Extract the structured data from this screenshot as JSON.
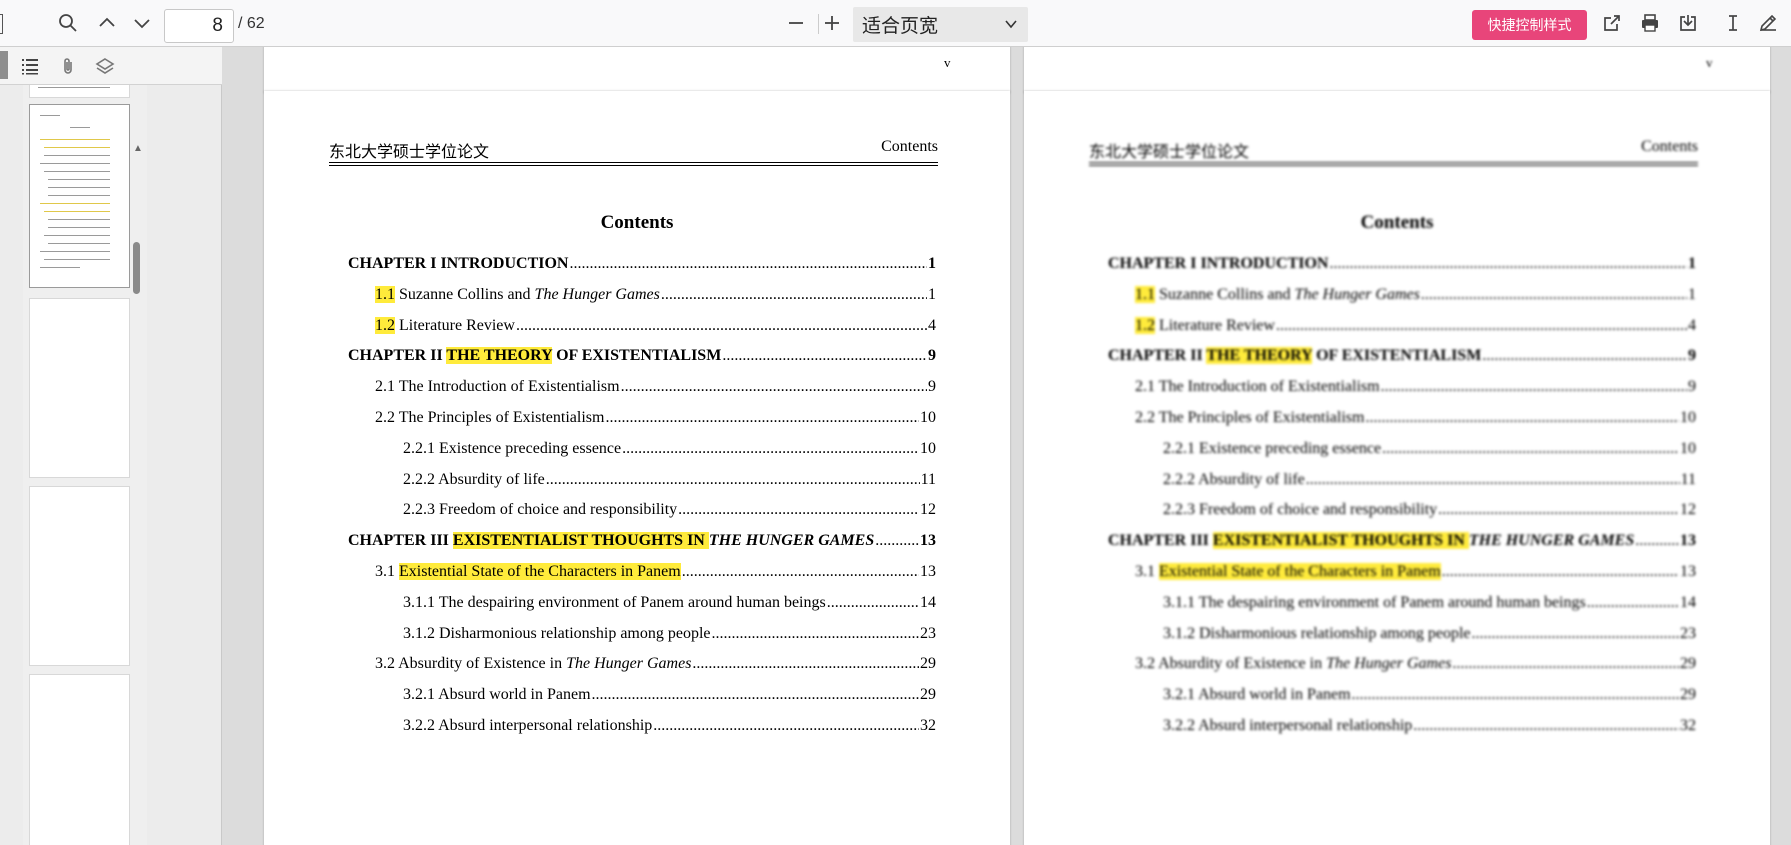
{
  "toolbar": {
    "page_current": "8",
    "page_total": "/ 62",
    "zoom_label": "适合页宽",
    "quick_style_label": "快捷控制样式",
    "icons": [
      "search-icon",
      "chevron-up-icon",
      "chevron-down-icon",
      "zoom-out-icon",
      "zoom-in-icon",
      "open-external-icon",
      "print-icon",
      "download-icon",
      "text-cursor-icon",
      "pen-icon"
    ]
  },
  "sidebar": {
    "tabs": [
      "outline-list-icon",
      "attachment-icon",
      "layers-icon"
    ]
  },
  "prev_page": {
    "left_mark": "v",
    "right_mark": "v"
  },
  "page": {
    "header_left": "东北大学硕士学位论文",
    "header_right": "Contents",
    "title": "Contents"
  },
  "toc": [
    {
      "parts": [
        {
          "t": "CHAPTER I INTRODUCTION"
        }
      ],
      "page": "1",
      "level": 0
    },
    {
      "parts": [
        {
          "t": "1.1",
          "hl": true
        },
        {
          "t": " Suzanne Collins and "
        },
        {
          "t": "The Hunger Games",
          "it": true
        }
      ],
      "page": "1",
      "level": 1
    },
    {
      "parts": [
        {
          "t": "1.2",
          "hl": true
        },
        {
          "t": " Literature Review"
        }
      ],
      "page": "4",
      "level": 1
    },
    {
      "parts": [
        {
          "t": "CHAPTER II "
        },
        {
          "t": "THE THEORY",
          "hl": true
        },
        {
          "t": " OF EXISTENTIALISM"
        }
      ],
      "page": " 9",
      "level": 0
    },
    {
      "parts": [
        {
          "t": "2.1 The Introduction of Existentialism"
        }
      ],
      "page": "9",
      "level": 1
    },
    {
      "parts": [
        {
          "t": "2.2 The Principles of Existentialism"
        }
      ],
      "page": " 10",
      "level": 1
    },
    {
      "parts": [
        {
          "t": "2.2.1 Existence preceding essence"
        }
      ],
      "page": " 10",
      "level": 2
    },
    {
      "parts": [
        {
          "t": "2.2.2 Absurdity of life"
        }
      ],
      "page": " 11",
      "level": 2
    },
    {
      "parts": [
        {
          "t": "2.2.3 Freedom of choice and responsibility"
        }
      ],
      "page": " 12",
      "level": 2
    },
    {
      "parts": [
        {
          "t": "CHAPTER III "
        },
        {
          "t": "EXISTENTIALIST THOUGHTS IN ",
          "hl": true
        },
        {
          "t": "THE HUNGER GAMES",
          "it": true
        }
      ],
      "page": " 13",
      "level": 0
    },
    {
      "parts": [
        {
          "t": "3.1 "
        },
        {
          "t": "Existential State of the Characters in Panem",
          "hl": true
        }
      ],
      "page": " 13",
      "level": 1
    },
    {
      "parts": [
        {
          "t": "3.1.1 The despairing environment of Panem around human beings"
        }
      ],
      "page": " 14",
      "level": 2
    },
    {
      "parts": [
        {
          "t": "3.1.2 Disharmonious relationship among people"
        }
      ],
      "page": "23",
      "level": 2
    },
    {
      "parts": [
        {
          "t": "3.2 Absurdity of Existence in "
        },
        {
          "t": "The Hunger Games",
          "it": true
        }
      ],
      "page": "29",
      "level": 1
    },
    {
      "parts": [
        {
          "t": "3.2.1 Absurd world in Panem"
        }
      ],
      "page": "29",
      "level": 2
    },
    {
      "parts": [
        {
          "t": "3.2.2 Absurd interpersonal relationship"
        }
      ],
      "page": " 32",
      "level": 2
    }
  ]
}
